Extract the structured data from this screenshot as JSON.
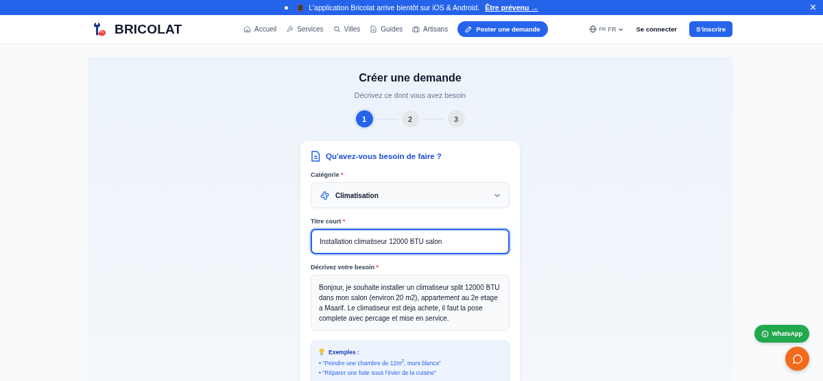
{
  "banner": {
    "text": "L'application Bricolat arrive bientôt sur iOS & Android.",
    "link": "Être prévenu →",
    "close": "×"
  },
  "header": {
    "logo": "BRICOLAT",
    "nav": [
      {
        "label": "Accueil"
      },
      {
        "label": "Services"
      },
      {
        "label": "Villes"
      },
      {
        "label": "Guides"
      },
      {
        "label": "Artisans"
      }
    ],
    "cta": "Poster une demande",
    "lang_code": "FR",
    "lang": "FR",
    "login": "Se connecter",
    "signup": "S'inscrire"
  },
  "page": {
    "title": "Créer une demande",
    "subtitle": "Décrivez ce dont vous avez besoin",
    "steps": [
      {
        "label": "1",
        "selected": true
      },
      {
        "label": "2",
        "selected": false
      },
      {
        "label": "3",
        "selected": false
      }
    ]
  },
  "form": {
    "heading": "Qu'avez-vous besoin de faire ?",
    "category": {
      "label": "Catégorie",
      "required_mark": "*",
      "value": "Climatisation"
    },
    "title": {
      "label": "Titre court",
      "required_mark": "*",
      "value": "Installation climatiseur 12000 BTU salon",
      "focused": true
    },
    "description": {
      "label": "Décrivez votre besoin",
      "required_mark": "*",
      "value": "Bonjour, je souhaite installer un climatiseur split 12000 BTU dans mon salon (environ 20 m2), appartement au 2e etage a Maarif. Le climatiseur est deja achete, il faut la pose complete avec percage et mise en service."
    },
    "examples": {
      "title": "Exemples :",
      "items": [
        "• \"Peindre une chambre de 12m$^{2}$, murs blancs\"",
        "• \"Réparer une fuite sous l'évier de la cuisine\""
      ]
    }
  },
  "whatsapp": "WhatsApp"
}
